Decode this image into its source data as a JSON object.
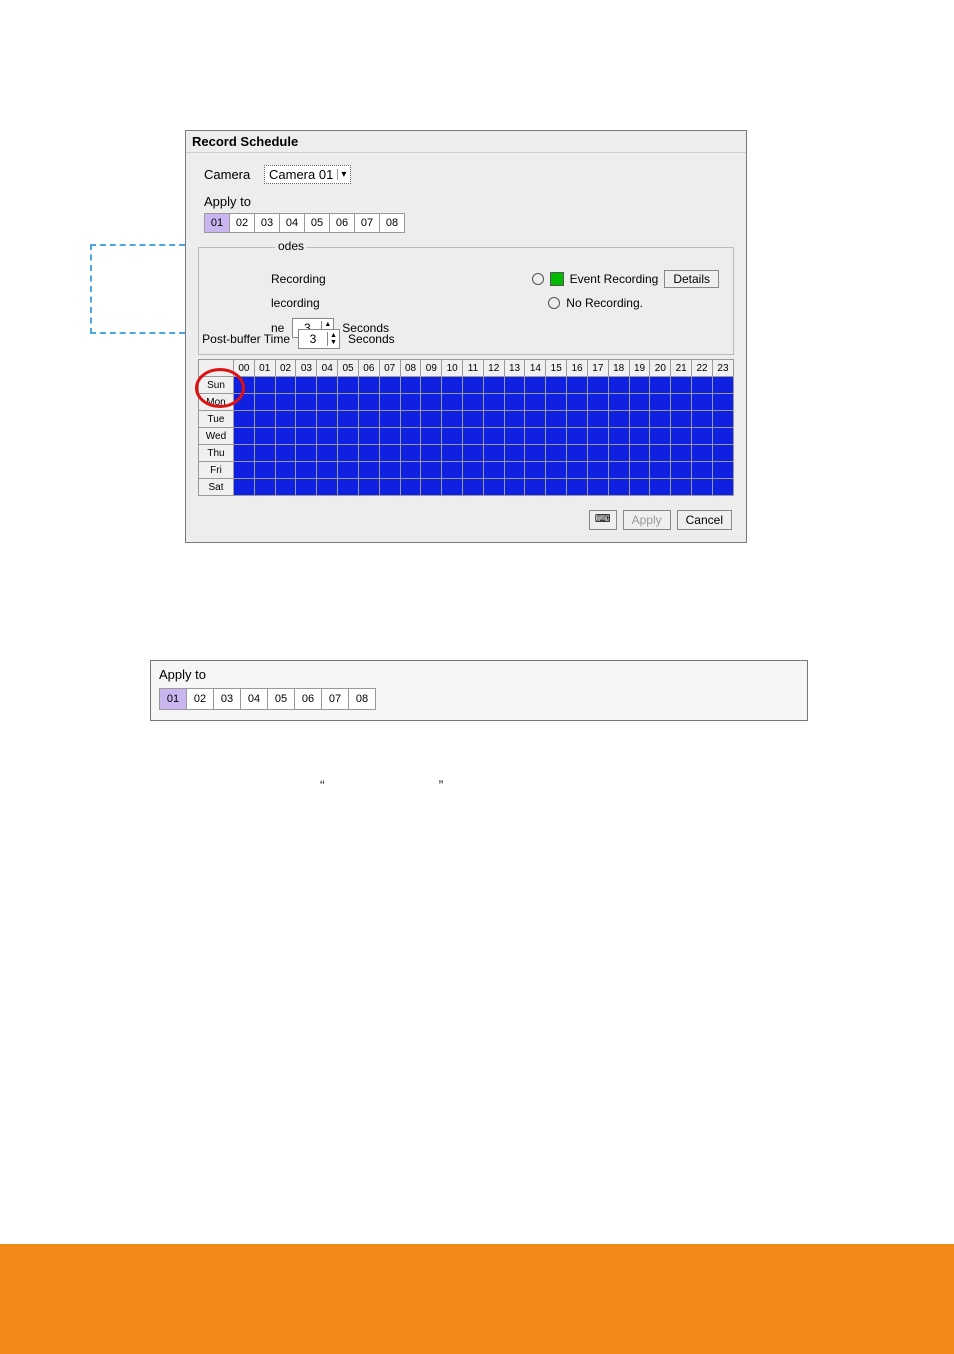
{
  "dialog": {
    "title": "Record Schedule",
    "camera_label": "Camera",
    "camera_value": "Camera 01",
    "apply_to_label": "Apply to",
    "apply_cells": [
      "01",
      "02",
      "03",
      "04",
      "05",
      "06",
      "07",
      "08"
    ],
    "apply_selected": "01",
    "modes_legend": "odes",
    "mode_rec": "Recording",
    "mode_lec": "lecording",
    "mode_evt": "Event Recording",
    "mode_none": "No Recording.",
    "details_btn": "Details",
    "buf1_label": "ne",
    "buf1_value": "3",
    "buf1_unit": "Seconds",
    "buf2_label": "Post-buffer Time",
    "buf2_value": "3",
    "buf2_unit": "Seconds",
    "hours": [
      "00",
      "01",
      "02",
      "03",
      "04",
      "05",
      "06",
      "07",
      "08",
      "09",
      "10",
      "11",
      "12",
      "13",
      "14",
      "15",
      "16",
      "17",
      "18",
      "19",
      "20",
      "21",
      "22",
      "23"
    ],
    "days": [
      "Sun",
      "Mon",
      "Tue",
      "Wed",
      "Thu",
      "Fri",
      "Sat"
    ],
    "kb_icon": "⌨",
    "apply_btn": "Apply",
    "cancel_btn": "Cancel"
  },
  "fig2": {
    "title": "Apply to",
    "cells": [
      "01",
      "02",
      "03",
      "04",
      "05",
      "06",
      "07",
      "08"
    ],
    "selected": "01"
  },
  "quotes": {
    "open": "“",
    "close": "”"
  }
}
